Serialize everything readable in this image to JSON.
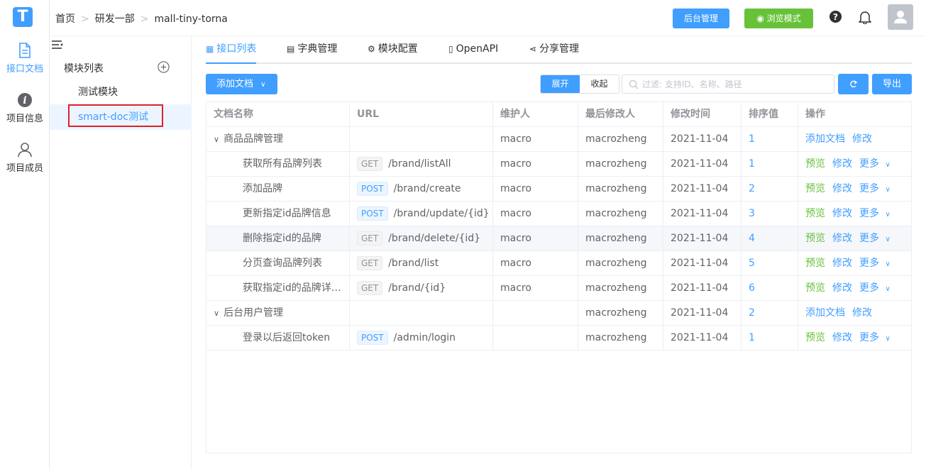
{
  "rail": {
    "logo": "T",
    "items": [
      {
        "label": "接口文档",
        "icon": "document-icon"
      },
      {
        "label": "项目信息",
        "icon": "info-icon"
      },
      {
        "label": "项目成员",
        "icon": "user-icon"
      }
    ]
  },
  "header": {
    "breadcrumb": [
      "首页",
      "研发一部",
      "mall-tiny-torna"
    ],
    "admin_button": "后台管理",
    "browse_button": "浏览模式"
  },
  "modules": {
    "title": "模块列表",
    "items": [
      "测试模块",
      "smart-doc测试"
    ]
  },
  "tabs": [
    "接口列表",
    "字典管理",
    "模块配置",
    "OpenAPI",
    "分享管理"
  ],
  "toolbar": {
    "add_doc": "添加文档",
    "expand": "展开",
    "collapse": "收起",
    "search_placeholder": "过滤: 支持ID、名称、路径",
    "export": "导出"
  },
  "table": {
    "headers": [
      "文档名称",
      "URL",
      "维护人",
      "最后修改人",
      "修改时间",
      "排序值",
      "操作"
    ],
    "rows": [
      {
        "type": "folder",
        "name": "商品品牌管理",
        "method": "",
        "url": "",
        "maintainer": "macro",
        "modifier": "macrozheng",
        "time": "2021-11-04",
        "order": "1",
        "actions": [
          "添加文档",
          "修改"
        ]
      },
      {
        "type": "doc",
        "name": "获取所有品牌列表",
        "method": "GET",
        "url": "/brand/listAll",
        "maintainer": "macro",
        "modifier": "macrozheng",
        "time": "2021-11-04",
        "order": "1",
        "actions": [
          "预览",
          "修改",
          "更多"
        ]
      },
      {
        "type": "doc",
        "name": "添加品牌",
        "method": "POST",
        "url": "/brand/create",
        "maintainer": "macro",
        "modifier": "macrozheng",
        "time": "2021-11-04",
        "order": "2",
        "actions": [
          "预览",
          "修改",
          "更多"
        ]
      },
      {
        "type": "doc",
        "name": "更新指定id品牌信息",
        "method": "POST",
        "url": "/brand/update/{id}",
        "maintainer": "macro",
        "modifier": "macrozheng",
        "time": "2021-11-04",
        "order": "3",
        "actions": [
          "预览",
          "修改",
          "更多"
        ]
      },
      {
        "type": "doc",
        "name": "删除指定id的品牌",
        "method": "GET",
        "url": "/brand/delete/{id}",
        "maintainer": "macro",
        "modifier": "macrozheng",
        "time": "2021-11-04",
        "order": "4",
        "actions": [
          "预览",
          "修改",
          "更多"
        ]
      },
      {
        "type": "doc",
        "name": "分页查询品牌列表",
        "method": "GET",
        "url": "/brand/list",
        "maintainer": "macro",
        "modifier": "macrozheng",
        "time": "2021-11-04",
        "order": "5",
        "actions": [
          "预览",
          "修改",
          "更多"
        ]
      },
      {
        "type": "doc",
        "name": "获取指定id的品牌详…",
        "method": "GET",
        "url": "/brand/{id}",
        "maintainer": "macro",
        "modifier": "macrozheng",
        "time": "2021-11-04",
        "order": "6",
        "actions": [
          "预览",
          "修改",
          "更多"
        ]
      },
      {
        "type": "folder",
        "name": "后台用户管理",
        "method": "",
        "url": "",
        "maintainer": "",
        "modifier": "macrozheng",
        "time": "2021-11-04",
        "order": "2",
        "actions": [
          "添加文档",
          "修改"
        ]
      },
      {
        "type": "doc",
        "name": "登录以后返回token",
        "method": "POST",
        "url": "/admin/login",
        "maintainer": "",
        "modifier": "macrozheng",
        "time": "2021-11-04",
        "order": "1",
        "actions": [
          "预览",
          "修改",
          "更多"
        ]
      }
    ]
  },
  "colors": {
    "primary": "#409eff",
    "success": "#67c23a",
    "highlight": "#e0202a"
  }
}
